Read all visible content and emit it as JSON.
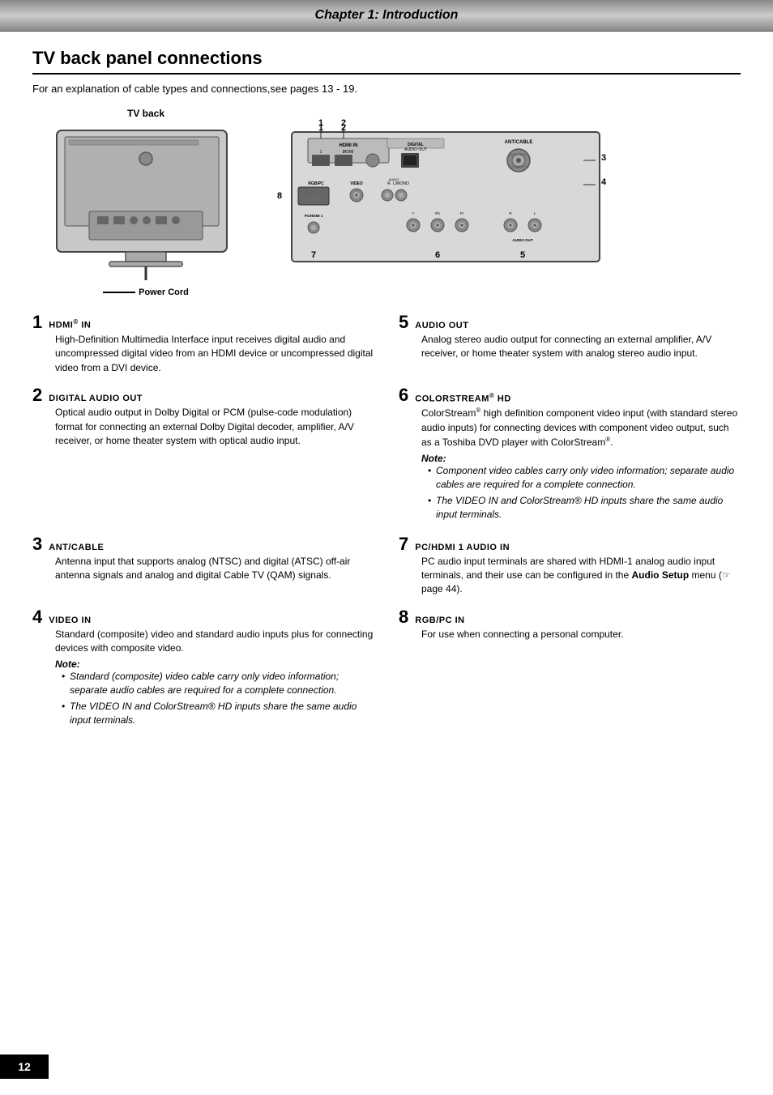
{
  "header": {
    "title": "Chapter 1: Introduction"
  },
  "section": {
    "title": "TV back panel connections",
    "intro": "For an explanation of cable types and connections,see pages 13 - 19.",
    "tv_back_label": "TV back",
    "power_cord_label": "Power Cord"
  },
  "items": [
    {
      "number": "1",
      "name": "HDMI",
      "name_sup": "®",
      "name_after": " IN",
      "desc": "High-Definition Multimedia Interface input receives digital audio and uncompressed digital video from an HDMI device or uncompressed digital video from a DVI device.",
      "note": null,
      "notes_list": []
    },
    {
      "number": "2",
      "name": "DIGITAL AUDIO OUT",
      "name_sup": "",
      "name_after": "",
      "desc": "Optical audio output in Dolby Digital or PCM (pulse-code modulation) format for connecting an external Dolby Digital decoder, amplifier, A/V receiver, or home theater system with optical audio input.",
      "note": null,
      "notes_list": []
    },
    {
      "number": "3",
      "name": "ANT/CABLE",
      "name_sup": "",
      "name_after": "",
      "desc": "Antenna input that supports analog (NTSC) and digital (ATSC) off-air antenna signals and analog and digital Cable TV (QAM) signals.",
      "note": null,
      "notes_list": []
    },
    {
      "number": "4",
      "name": "VIDEO IN",
      "name_sup": "",
      "name_after": "",
      "desc": "Standard (composite) video and standard audio inputs plus for connecting devices with composite video.",
      "note": "Note:",
      "notes_list": [
        "Standard (composite) video cable carry only video information; separate audio cables are required for a complete connection.",
        "The VIDEO IN and ColorStream® HD inputs share the same audio input terminals."
      ]
    },
    {
      "number": "5",
      "name": "AUDIO OUT",
      "name_sup": "",
      "name_after": "",
      "desc": "Analog stereo audio output for connecting an external amplifier, A/V receiver, or home theater system with analog stereo audio input.",
      "note": null,
      "notes_list": []
    },
    {
      "number": "6",
      "name": "ColorStream",
      "name_sup": "®",
      "name_after": " HD",
      "desc": "ColorStream® high definition component video input (with standard stereo audio inputs) for connecting devices with component video output, such as a Toshiba DVD player with ColorStream®.",
      "note": "Note:",
      "notes_list": [
        "Component video cables carry only video information; separate audio cables are required for a complete connection.",
        "The VIDEO IN and ColorStream® HD inputs share the same audio input terminals."
      ]
    },
    {
      "number": "7",
      "name": "PC/HDMI 1 AUDIO IN",
      "name_sup": "",
      "name_after": "",
      "desc": "PC audio input terminals are shared with HDMI-1 analog audio input terminals, and their use can be configured in the Audio Setup menu (☞ page 44).",
      "note": null,
      "notes_list": []
    },
    {
      "number": "8",
      "name": "RGB/PC IN",
      "name_sup": "",
      "name_after": "",
      "desc": "For use when connecting a personal computer.",
      "note": null,
      "notes_list": []
    }
  ],
  "footer": {
    "page_number": "12"
  }
}
